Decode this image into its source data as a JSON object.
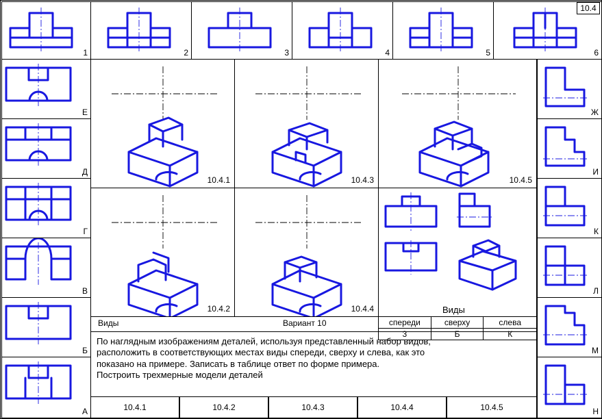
{
  "page_code": "10.4",
  "top_labels": [
    "1",
    "2",
    "3",
    "4",
    "5",
    "6"
  ],
  "left_labels": [
    "Е",
    "Д",
    "Г",
    "В",
    "Б",
    "А"
  ],
  "right_labels": [
    "Ж",
    "И",
    "К",
    "Л",
    "М",
    "Н"
  ],
  "central_labels": [
    "10.4.1",
    "10.4.2",
    "10.4.3",
    "10.4.4",
    "10.4.5"
  ],
  "titles": {
    "vidy": "Виды",
    "variant": "Вариант  10",
    "vidy2": "Виды"
  },
  "answers": {
    "headers": [
      "спереди",
      "сверху",
      "слева"
    ],
    "values": [
      "3",
      "Б",
      "К"
    ]
  },
  "instructions": {
    "line1": "По наглядным изображениям деталей, используя представленный набор видов,",
    "line2": "расположить в соответствующих местах виды спереди, сверху и слева, как это",
    "line3": "показано на примере. Записать в таблице ответ по форме  примера.",
    "line4": "Построить трехмерные модели деталей"
  },
  "bottom_cells": [
    "10.4.1",
    "10.4.2",
    "10.4.3",
    "10.4.4",
    "10.4.5"
  ]
}
